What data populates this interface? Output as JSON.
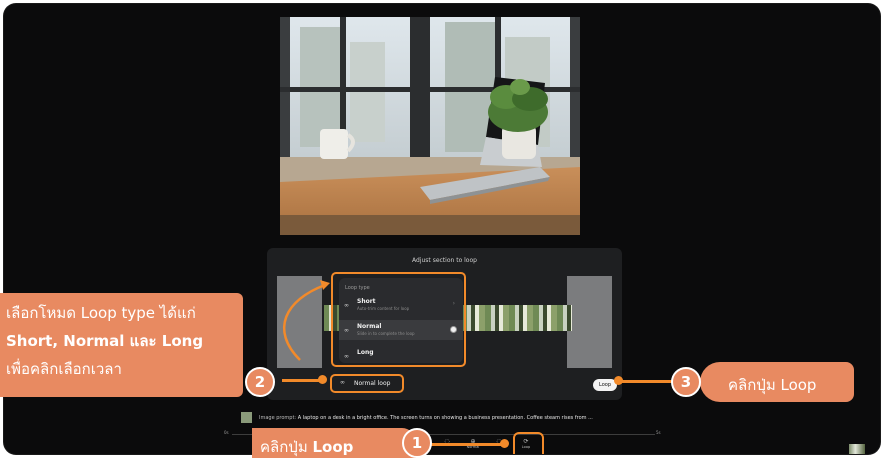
{
  "panel": {
    "title": "Adjust section to loop"
  },
  "loop_menu": {
    "header": "Loop type",
    "items": [
      {
        "icon": "short-loop-icon",
        "title": "Short",
        "subtitle": "Auto-trim content for loop",
        "selected": false
      },
      {
        "icon": "normal-loop-icon",
        "title": "Normal",
        "subtitle": "Slide in to complete the loop",
        "selected": true
      },
      {
        "icon": "long-loop-icon",
        "title": "Long",
        "subtitle": "",
        "selected": false
      }
    ]
  },
  "loop_selector": {
    "label": "Normal loop"
  },
  "loop_button": {
    "label": "Loop"
  },
  "prompt_bar": {
    "prefix": "Image prompt:",
    "text": "A laptop on a desk in a bright office. The screen turns on showing a business presentation. Coffee steam rises from ..."
  },
  "timeline": {
    "start": "0s",
    "end": "5s"
  },
  "toolbar": [
    {
      "icon": "tool-icon",
      "label": ""
    },
    {
      "icon": "normal-icon",
      "label": "Normal"
    },
    {
      "icon": "tool-icon",
      "label": ""
    },
    {
      "icon": "loop-icon",
      "label": "Loop"
    }
  ],
  "callouts": {
    "left": {
      "line1": "เลือกโหมด Loop type ได้แก่",
      "line2": "Short, Normal และ Long",
      "line3": "เพื่อคลิกเลือกเวลา"
    },
    "right": {
      "text": "คลิกปุ่ม Loop"
    },
    "bottom": {
      "text_normal": "คลิกปุ่ม ",
      "text_bold": "Loop"
    }
  },
  "badges": [
    "1",
    "2",
    "3"
  ],
  "colors": {
    "accent": "#f28a2a",
    "callout": "#e88a61",
    "background": "#0b0b0c"
  }
}
